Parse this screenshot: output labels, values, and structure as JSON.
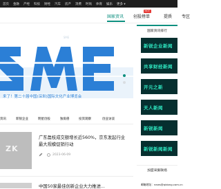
{
  "topbar": {
    "items": [
      "首页",
      "金融",
      "产经",
      "科技",
      "财经",
      "汽车",
      "房产",
      "消费",
      "时尚",
      "体育",
      "娱乐",
      "更多 ▾"
    ]
  },
  "nav": {
    "items": [
      "国家资讯",
      "创投榜单",
      "提质",
      "专区"
    ],
    "active_index": 0,
    "hot_badge": "HOT"
  },
  "banner": {
    "logo_text": "SME",
    "caption": "来了！第二十届中国(深圳)国际文化产业博览会",
    "slide_count": 2,
    "active_slide": 0
  },
  "categories": [
    "资讯",
    "新锐企业",
    "明星创投",
    "独角兽",
    "投资观察",
    "创业访谈"
  ],
  "article": {
    "title": "广东磊枝成交额增长近560%，京东发起行业最大规模促销行动",
    "date": "2023-06-09",
    "thumb_watermark": "ZK"
  },
  "article2": {
    "title": "中国50家最佳创新企业大力推进..."
  },
  "sidebar": {
    "header": "国家资讯排行",
    "tiles": [
      "新锐企业新闻",
      "共享财经新闻",
      "开元之新",
      "天人新闻",
      "新锐新闻",
      "新锐新闻新闻"
    ],
    "header2": "加盟采集联络",
    "email_label": "邮箱地址：",
    "email": "news@qidong.com.cn"
  },
  "colors": {
    "accent": "#0c8f7f",
    "tile_bg": "#062f2f",
    "tile_text": "#2ee6c0",
    "banner_blue": "#2b7fd6",
    "topbar_bg": "#1e1e1e"
  },
  "icons": {
    "pen": "pen-icon",
    "time": "clock-icon"
  }
}
